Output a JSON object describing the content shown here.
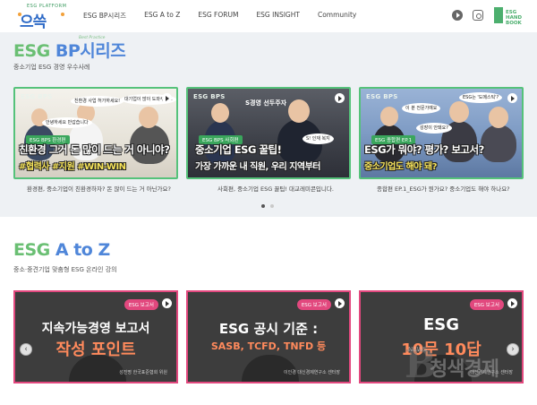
{
  "header": {
    "logo_small": "ESG PLATFORM",
    "logo_main": "으쓱",
    "nav": [
      "ESG BP시리즈",
      "ESG A to Z",
      "ESG FORUM",
      "ESG INSIGHT",
      "Community"
    ],
    "handbook_label": "ESG HAND BOOK"
  },
  "bp_series": {
    "title_part1": "ESG",
    "title_part2": "BP시리즈",
    "best_practice": "Best Practice",
    "subtitle": "중소기업 ESG 경영 우수사례",
    "cards": [
      {
        "tag": "ESG BPS",
        "badge": "ESG BPS 환경편",
        "line1": "친환경 그거 돈 많이 드는 거 아니야?",
        "line2": "#협력사 #지원 #WIN-WIN",
        "line2_color": "#f6e35a",
        "bubbles": [
          "친환경 사업 허가하세요!",
          "대기업이 많이 도와주세요",
          "안녕하세요 반갑습니다"
        ],
        "caption": "환경편, 중소기업이 친환경하자? 돈 많이 드는 거 아닌가요?"
      },
      {
        "tag": "ESG BPS",
        "badge": "ESG BPS 사회편",
        "line1": "중소기업 ESG 꿀팁!",
        "line2": "가장 가까운 내 직원, 우리 지역부터",
        "line2_color": "#ffffff",
        "bubbles": [
          "S경영 선두주자",
          "S! 인재 복지"
        ],
        "caption": "사회편, 중소기업 ESG 꿀팁! 대교레미콘입니다."
      },
      {
        "tag": "ESG BPS",
        "badge": "ESG 종합편 EP.1",
        "line1": "ESG가 뭐야? 평가? 보고서?",
        "line2": "중소기업도 해야 돼?",
        "line2_color": "#f6e35a",
        "bubbles": [
          "ESG는 '도메스틱'?",
          "이 분 전문가예요",
          "성장이 안돼요?"
        ],
        "caption": "종합편 EP.1_ESG가 뭔가요? 중소기업도 해야 하나요?"
      }
    ]
  },
  "atoz": {
    "title_part1": "ESG",
    "title_part2": "A to Z",
    "subtitle": "중소·중견기업 맞춤형 ESG 온라인 강의",
    "cards": [
      {
        "pill": "ESG 보고서",
        "line1": "지속가능경영 보고서",
        "line2": "작성 포인트",
        "speaker": "성진명 한국표준협회 위원"
      },
      {
        "pill": "ESG 보고서",
        "line1": "ESG 공시 기준 :",
        "line2": "SASB, TCFD, TNFD 등",
        "speaker": "이인경 대신경제연구소 센터장"
      },
      {
        "pill": "ESG 보고서",
        "line1": "ESG",
        "line2": "10문 10답",
        "speaker": "대신경제연구소 센터장"
      }
    ],
    "prev_arrow": "‹",
    "next_arrow": "›"
  },
  "watermark": {
    "letter": "B",
    "news": "NEWS",
    "text": "청색경제"
  }
}
